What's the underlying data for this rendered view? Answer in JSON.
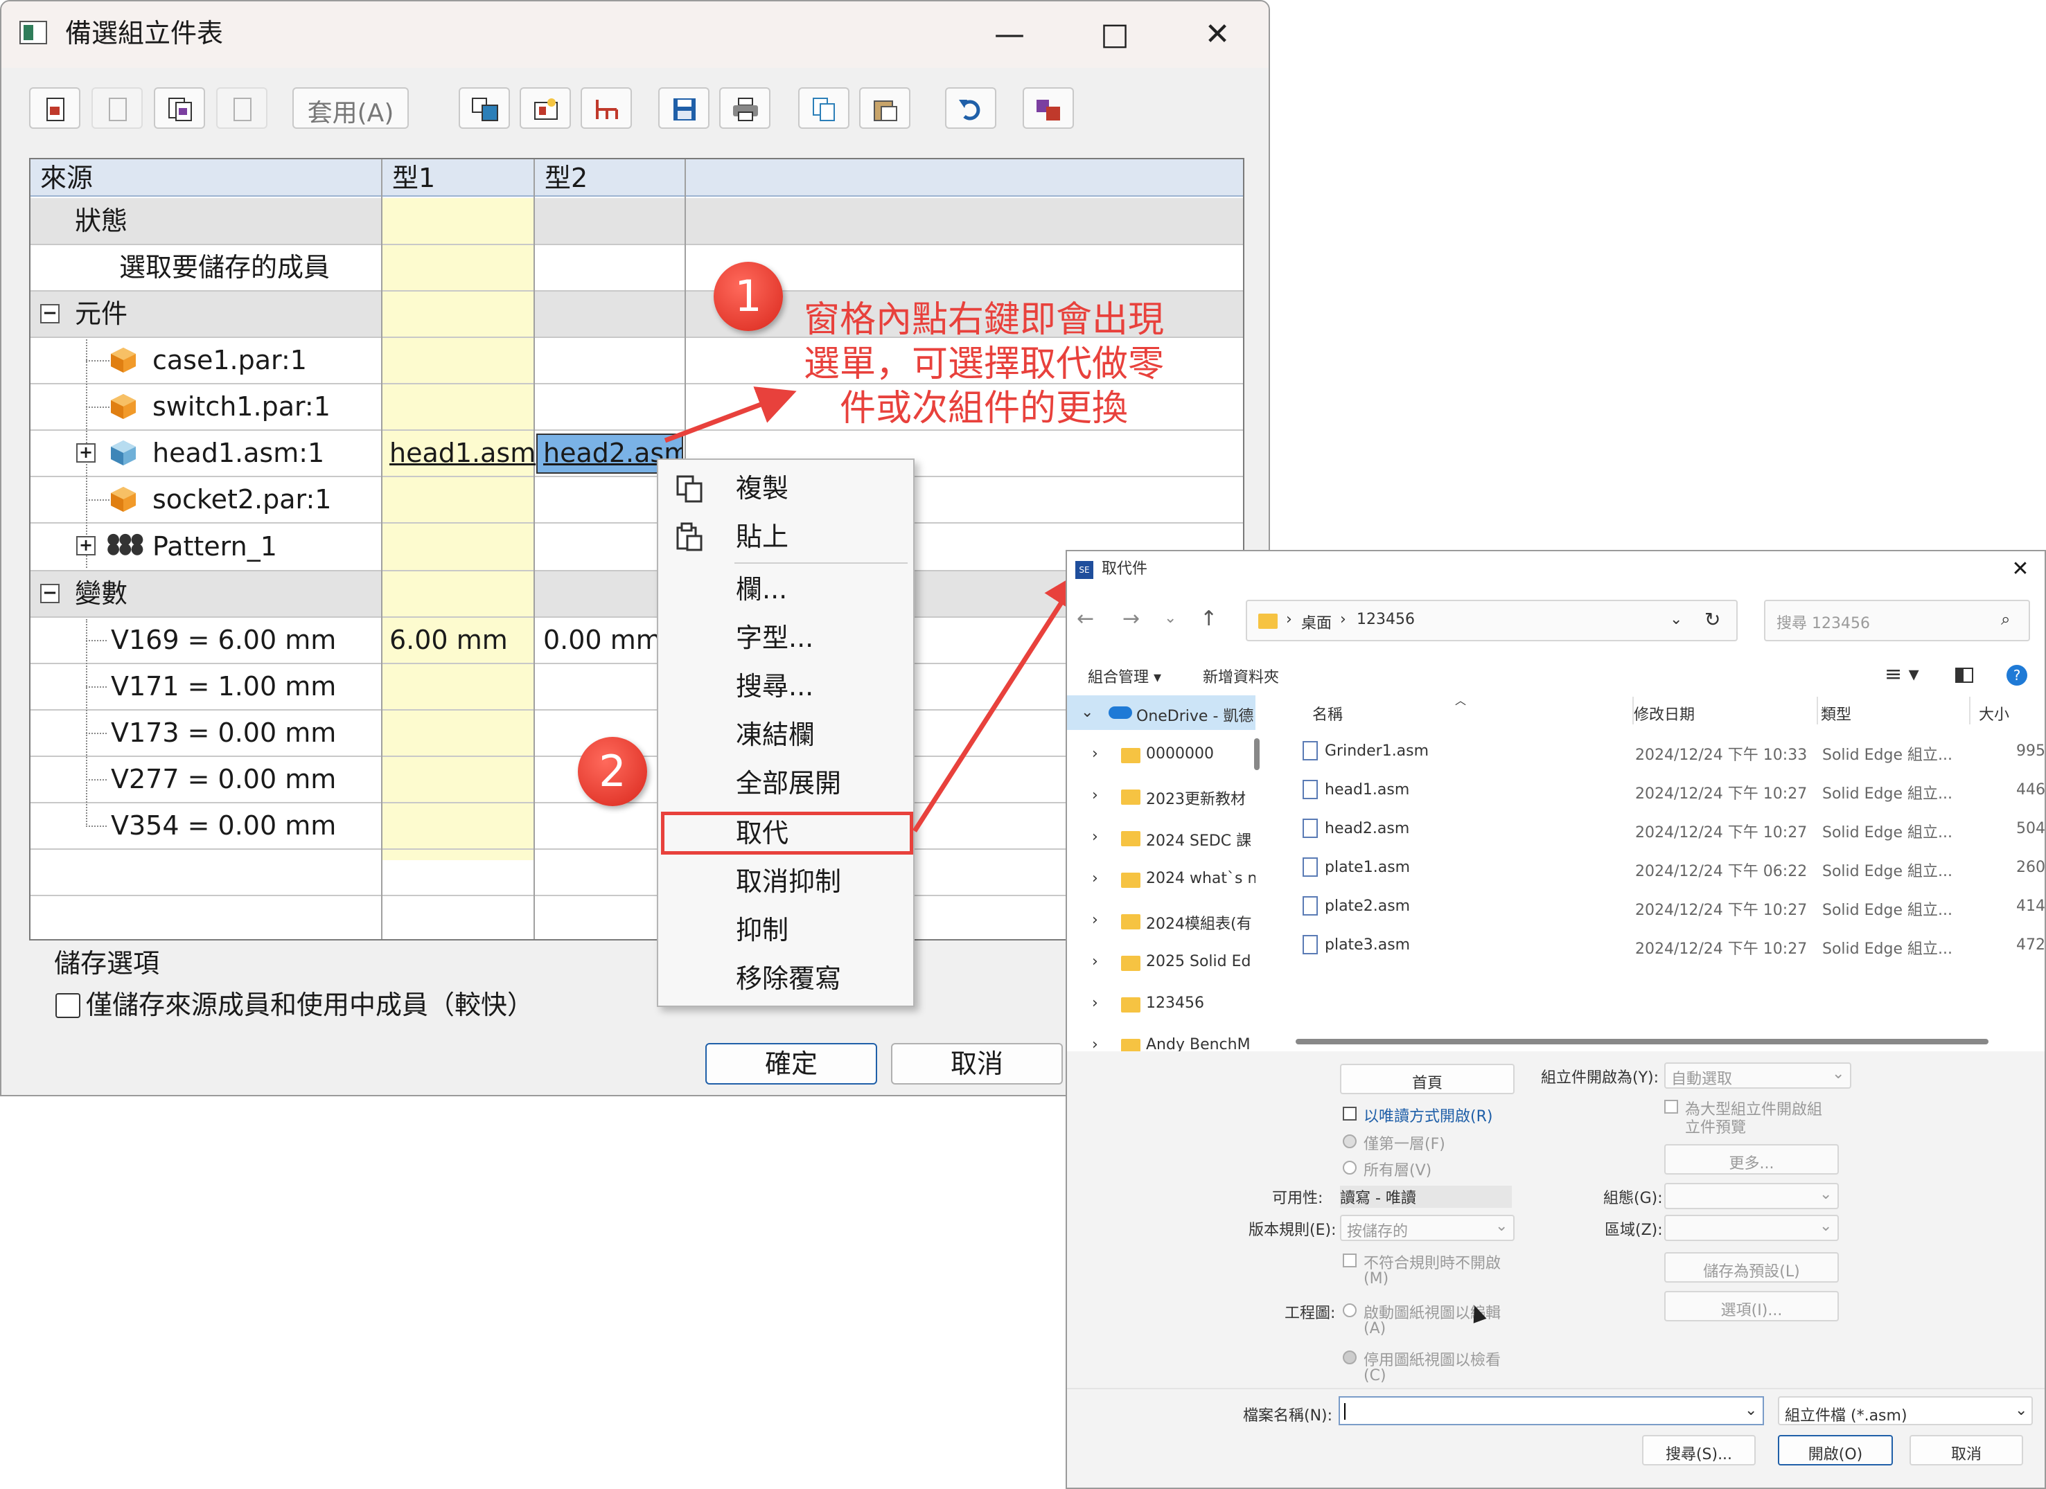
{
  "dialog": {
    "title": "備選組立件表",
    "toolbar_apply": "套用(A)",
    "columns": [
      "來源",
      "型1",
      "型2"
    ],
    "rows": {
      "status": "狀態",
      "select_members": "選取要儲存的成員",
      "components": "元件",
      "case1": "case1.par:1",
      "switch1": "switch1.par:1",
      "head1": "head1.asm:1",
      "socket2": "socket2.par:1",
      "pattern": "Pattern_1",
      "variables": "變數",
      "v169": "V169 = 6.00 mm",
      "v171": "V171 = 1.00 mm",
      "v173": "V173 = 0.00 mm",
      "v277": "V277 = 0.00 mm",
      "v354": "V354 = 0.00 mm"
    },
    "cells": {
      "head1_type1": "head1.asm",
      "head1_type2": "head2.asm",
      "v169_type1": "6.00 mm",
      "v169_type2": "0.00 mm"
    },
    "save_options_label": "儲存選項",
    "save_option_checkbox": "僅儲存來源成員和使用中成員（較快）",
    "ok": "確定",
    "cancel": "取消"
  },
  "context_menu": {
    "items": [
      "複製",
      "貼上",
      "欄...",
      "字型...",
      "搜尋...",
      "凍結欄",
      "全部展開",
      "取代",
      "取消抑制",
      "抑制",
      "移除覆寫"
    ],
    "highlighted": "取代"
  },
  "annotations": {
    "badge1": "1",
    "badge2": "2",
    "note": "窗格內點右鍵即會出現選單，可選擇取代做零件或次組件的更換",
    "note_line1": "窗格內點右鍵即會出現",
    "note_line2": "選單，可選擇取代做零",
    "note_line3": "件或次組件的更換",
    "color": "#e8413c"
  },
  "file_dialog": {
    "title": "取代件",
    "path": [
      "桌面",
      "123456"
    ],
    "search_placeholder": "搜尋 123456",
    "organize": "組合管理 ▾",
    "new_folder": "新增資料夾",
    "nav": [
      {
        "label": "OneDrive - 凱德"
      },
      {
        "label": "0000000"
      },
      {
        "label": "2023更新教材"
      },
      {
        "label": "2024 SEDC 課"
      },
      {
        "label": "2024 what`s n"
      },
      {
        "label": "2024模組表(有"
      },
      {
        "label": "2025 Solid Ed"
      },
      {
        "label": "123456"
      },
      {
        "label": "Andy BenchM"
      }
    ],
    "columns": [
      "名稱",
      "修改日期",
      "類型",
      "大小"
    ],
    "files": [
      {
        "name": "Grinder1.asm",
        "date": "2024/12/24 下午 10:33",
        "type": "Solid Edge 組立...",
        "size": "995"
      },
      {
        "name": "head1.asm",
        "date": "2024/12/24 下午 10:27",
        "type": "Solid Edge 組立...",
        "size": "446"
      },
      {
        "name": "head2.asm",
        "date": "2024/12/24 下午 10:27",
        "type": "Solid Edge 組立...",
        "size": "504"
      },
      {
        "name": "plate1.asm",
        "date": "2024/12/24 下午 06:22",
        "type": "Solid Edge 組立...",
        "size": "260"
      },
      {
        "name": "plate2.asm",
        "date": "2024/12/24 下午 10:27",
        "type": "Solid Edge 組立...",
        "size": "414"
      },
      {
        "name": "plate3.asm",
        "date": "2024/12/24 下午 10:27",
        "type": "Solid Edge 組立...",
        "size": "472"
      }
    ],
    "options": {
      "home": "首頁",
      "readonly": "以唯讀方式開啟(R)",
      "only_first": "僅第一層(F)",
      "all_levels": "所有層(V)",
      "availability_label": "可用性:",
      "availability_value": "讀寫 - 唯讀",
      "version_rule_label": "版本規則(E):",
      "version_rule_value": "按儲存的",
      "noncompliant": "不符合規則時不開啟",
      "noncompliant_key": "(M)",
      "drawing_label": "工程圖:",
      "enable_views": "啟動圖紙視圖以編輯",
      "enable_views_key": "(A)",
      "disable_views": "停用圖紙視圖以檢看",
      "disable_views_key": "(C)",
      "open_as_label": "組立件開啟為(Y):",
      "open_as_value": "自動選取",
      "large_asm": "為大型組立件開啟組",
      "large_asm2": "立件預覽",
      "more": "更多...",
      "config_label": "組態(G):",
      "zone_label": "區域(Z):",
      "save_default": "儲存為預設(L)",
      "options": "選項(I)..."
    },
    "filename_label": "檔案名稱(N):",
    "filename_value": "",
    "filter": "組立件檔 (*.asm)",
    "search_btn": "搜尋(S)...",
    "open_btn": "開啟(O)",
    "cancel_btn": "取消"
  }
}
